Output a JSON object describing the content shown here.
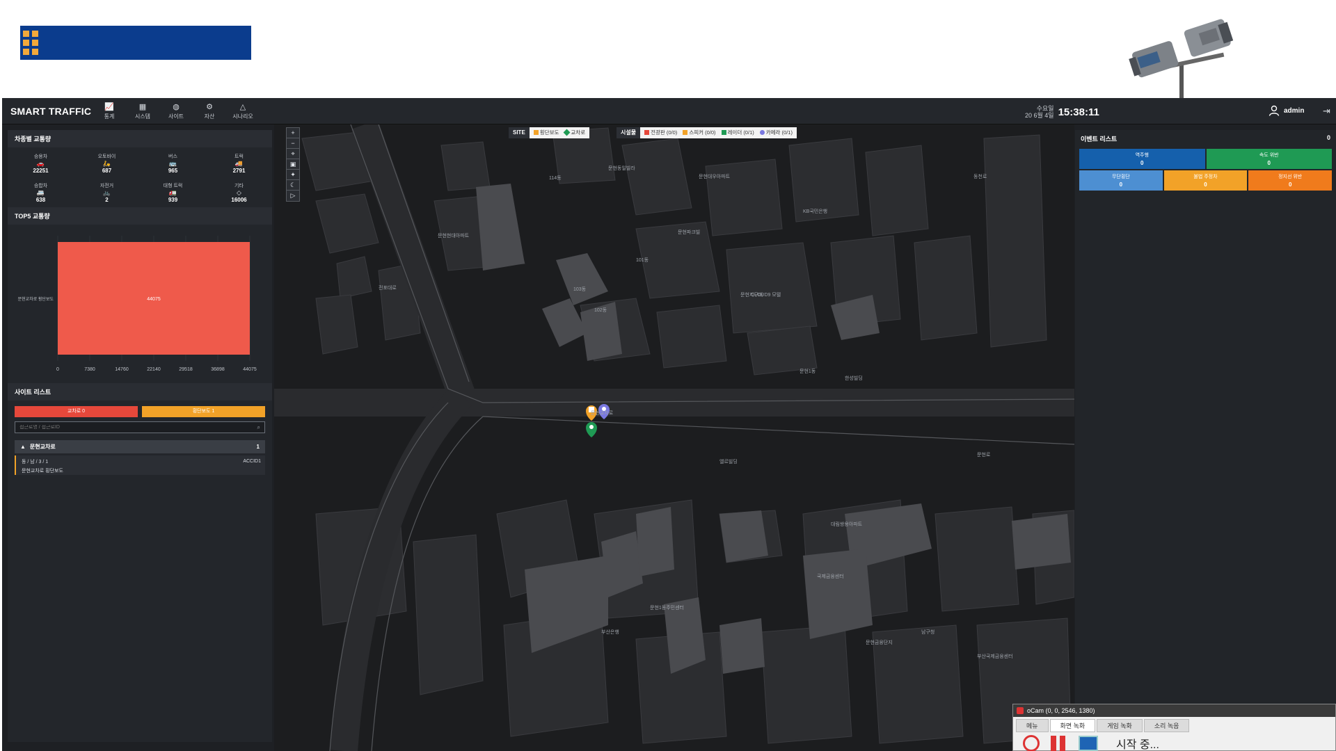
{
  "app": {
    "title": "SMART TRAFFIC",
    "nav": [
      {
        "label": "통계",
        "icon": "chart-line-icon"
      },
      {
        "label": "시스템",
        "icon": "grid-icon"
      },
      {
        "label": "사이트",
        "icon": "globe-icon"
      },
      {
        "label": "자산",
        "icon": "gear-icon"
      },
      {
        "label": "시나리오",
        "icon": "alert-triangle-icon"
      }
    ],
    "date_line1": "수요일",
    "date_line2": "20  6월 4일",
    "time": "15:38:11",
    "user": "admin"
  },
  "vehicle_stats": {
    "title": "차종별 교통량",
    "items": [
      {
        "label": "승용차",
        "value": "22251",
        "icon": "car-icon"
      },
      {
        "label": "오토바이",
        "value": "687",
        "icon": "motorcycle-icon"
      },
      {
        "label": "버스",
        "value": "965",
        "icon": "bus-icon"
      },
      {
        "label": "트럭",
        "value": "2791",
        "icon": "truck-icon"
      },
      {
        "label": "승합차",
        "value": "638",
        "icon": "van-icon"
      },
      {
        "label": "자전거",
        "value": "2",
        "icon": "bicycle-icon"
      },
      {
        "label": "대형 트럭",
        "value": "939",
        "icon": "large-truck-icon"
      },
      {
        "label": "기타",
        "value": "16006",
        "icon": "other-icon"
      }
    ]
  },
  "top5": {
    "title": "TOP5 교통량"
  },
  "chart_data": {
    "type": "bar",
    "orientation": "horizontal",
    "categories": [
      "문현교차로 횡단보도"
    ],
    "values": [
      44075
    ],
    "data_labels": [
      "44075"
    ],
    "xlim": [
      0,
      44075
    ],
    "xticks": [
      "0",
      "7380",
      "14760",
      "22140",
      "29518",
      "36898",
      "44075"
    ],
    "bar_color": "#ef5a4b",
    "title": "",
    "xlabel": "",
    "ylabel": ""
  },
  "site_list": {
    "title": "사이트 리스트",
    "tab_intersection": "교차로 0",
    "tab_crosswalk": "횡단보도 1",
    "search_placeholder": "접근로명 / 접근로ID",
    "group_name": "문현교차로",
    "group_count": "1",
    "row_line1": "동 / 남 / 3 / 1",
    "row_line2": "문현교차로 횡단보도",
    "row_code": "ACCID1"
  },
  "map": {
    "site_tag": "SITE",
    "site_crosswalk": "횡단보도",
    "site_intersection": "교차로",
    "facility_tag": "시설물",
    "fac_electronic": "전광판 (0/0)",
    "fac_speaker": "스피커 (0/0)",
    "fac_radar": "레이더 (0/1)",
    "fac_camera": "카메라 (0/1)",
    "labels": [
      "114동",
      "문현동일빌라",
      "문현대우아파트",
      "101동",
      "102동",
      "103동",
      "문현1동",
      "CLOUD9 모텔",
      "문현교차로",
      "한성빌딩",
      "문현파크빌",
      "KB국민은행",
      "대림쌍용아파트",
      "문현금융단지",
      "동천로",
      "문현현대아파트",
      "전포대로",
      "문현1동주민센터",
      "부산은행",
      "엘르빌딩",
      "국제금융센터",
      "남구청",
      "부산국제금융센터",
      "문현지구대",
      "문현로"
    ]
  },
  "events": {
    "title": "이벤트 리스트",
    "count": "0",
    "cards": [
      {
        "label": "역주행",
        "value": "0",
        "color": "#1560ac"
      },
      {
        "label": "속도 위반",
        "value": "0",
        "color": "#1f9a54"
      },
      {
        "label": "무단횡단",
        "value": "0",
        "color": "#4d8fd2"
      },
      {
        "label": "불법 주정차",
        "value": "0",
        "color": "#f2a228"
      },
      {
        "label": "정지선 위반",
        "value": "0",
        "color": "#f07b1c"
      }
    ]
  },
  "ocam": {
    "title": "oCam (0, 0, 2546, 1380)",
    "tabs": [
      "메뉴",
      "화면 녹화",
      "게임 녹화",
      "소리 녹음"
    ],
    "status": "시작 중..."
  }
}
